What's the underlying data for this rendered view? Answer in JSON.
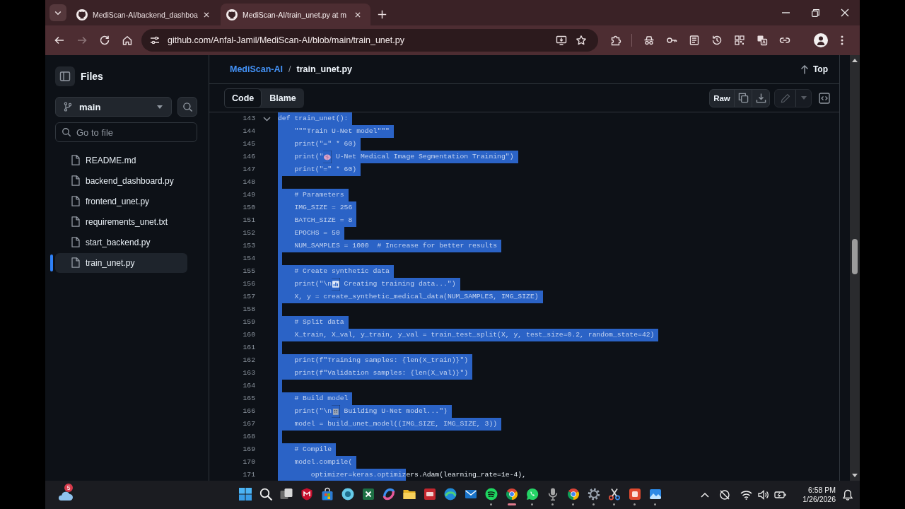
{
  "browser": {
    "tabs": [
      {
        "title": "MediScan-AI/backend_dashboa",
        "selected": false
      },
      {
        "title": "MediScan-AI/train_unet.py at m",
        "selected": true
      }
    ],
    "nav_buttons": [
      {
        "kind": "back",
        "disabled": false
      },
      {
        "kind": "forward",
        "disabled": true
      },
      {
        "kind": "reload",
        "disabled": false
      },
      {
        "kind": "home",
        "disabled": false
      }
    ],
    "address_bar": {
      "url": "github.com/Anfal-Jamil/MediScan-AI/blob/main/train_unet.py"
    }
  },
  "sidebar": {
    "title": "Files",
    "branch": "main",
    "search": {
      "placeholder": "Go to file"
    },
    "files": [
      {
        "name": "README.md",
        "selected": false
      },
      {
        "name": "backend_dashboard.py",
        "selected": false
      },
      {
        "name": "frontend_unet.py",
        "selected": false
      },
      {
        "name": "requirements_unet.txt",
        "selected": false
      },
      {
        "name": "start_backend.py",
        "selected": false
      },
      {
        "name": "train_unet.py",
        "selected": true
      }
    ]
  },
  "file_header": {
    "repo": "MediScan-AI",
    "separator": "/",
    "file": "train_unet.py",
    "top_link": "Top"
  },
  "view_tabs": [
    {
      "label": "Code",
      "selected": true
    },
    {
      "label": "Blame",
      "selected": false
    }
  ],
  "file_actions": {
    "raw": "Raw",
    "edit": {
      "disabled": true
    }
  },
  "code": {
    "lines": [
      {
        "number": "143",
        "selected": true,
        "expanded": true,
        "parts": [
          {
            "kind": "code",
            "text": "def train_unet():",
            "selected": true
          }
        ]
      },
      {
        "number": "144",
        "selected": true,
        "parts": [
          {
            "kind": "code",
            "text": "    \"\"\"Train U-Net model\"\"\"",
            "selected": true
          }
        ]
      },
      {
        "number": "145",
        "selected": true,
        "parts": [
          {
            "kind": "code",
            "text": "    print(\"=\" * 60)",
            "selected": true
          }
        ]
      },
      {
        "number": "146",
        "selected": true,
        "parts": [
          {
            "kind": "code",
            "text": "    print(\"",
            "selected": true
          },
          {
            "kind": "brain",
            "selected": true
          },
          {
            "kind": "code",
            "text": " U-Net Medical Image Segmentation Training\")",
            "selected": true
          }
        ]
      },
      {
        "number": "147",
        "selected": true,
        "parts": [
          {
            "kind": "code",
            "text": "    print(\"=\" * 60)",
            "selected": true
          }
        ]
      },
      {
        "number": "148",
        "selected": true
      },
      {
        "number": "149",
        "selected": true,
        "parts": [
          {
            "kind": "code",
            "text": "    # Parameters",
            "selected": true
          }
        ]
      },
      {
        "number": "150",
        "selected": true,
        "parts": [
          {
            "kind": "code",
            "text": "    IMG_SIZE = 256",
            "selected": true
          }
        ]
      },
      {
        "number": "151",
        "selected": true,
        "parts": [
          {
            "kind": "code",
            "text": "    BATCH_SIZE = 8",
            "selected": true
          }
        ]
      },
      {
        "number": "152",
        "selected": true,
        "parts": [
          {
            "kind": "code",
            "text": "    EPOCHS = 50",
            "selected": true
          }
        ]
      },
      {
        "number": "153",
        "selected": true,
        "parts": [
          {
            "kind": "code",
            "text": "    NUM_SAMPLES = 1000  # Increase for better results",
            "selected": true
          }
        ]
      },
      {
        "number": "154",
        "selected": true
      },
      {
        "number": "155",
        "selected": true,
        "parts": [
          {
            "kind": "code",
            "text": "    # Create synthetic data",
            "selected": true
          }
        ]
      },
      {
        "number": "156",
        "selected": true,
        "parts": [
          {
            "kind": "code",
            "text": "    print(\"\\n",
            "selected": true
          },
          {
            "kind": "chart",
            "selected": true
          },
          {
            "kind": "code",
            "text": " Creating training data...\")",
            "selected": true
          }
        ]
      },
      {
        "number": "157",
        "selected": true,
        "parts": [
          {
            "kind": "code",
            "text": "    X, y = create_synthetic_medical_data(NUM_SAMPLES, IMG_SIZE)",
            "selected": true
          }
        ]
      },
      {
        "number": "158",
        "selected": true
      },
      {
        "number": "159",
        "selected": true,
        "parts": [
          {
            "kind": "code",
            "text": "    # Split data",
            "selected": true
          }
        ]
      },
      {
        "number": "160",
        "selected": true,
        "parts": [
          {
            "kind": "code",
            "text": "    X_train, X_val, y_train, y_val = train_test_split(X, y, test_size=0.2, random_state=42)",
            "selected": true
          }
        ]
      },
      {
        "number": "161",
        "selected": true
      },
      {
        "number": "162",
        "selected": true,
        "parts": [
          {
            "kind": "code",
            "text": "    print(f\"Training samples: {len(X_train)}\")",
            "selected": true
          }
        ]
      },
      {
        "number": "163",
        "selected": true,
        "parts": [
          {
            "kind": "code",
            "text": "    print(f\"Validation samples: {len(X_val)}\")",
            "selected": true
          }
        ]
      },
      {
        "number": "164",
        "selected": true
      },
      {
        "number": "165",
        "selected": true,
        "parts": [
          {
            "kind": "code",
            "text": "    # Build model",
            "selected": true
          }
        ]
      },
      {
        "number": "166",
        "selected": true,
        "parts": [
          {
            "kind": "code",
            "text": "    print(\"\\n",
            "selected": true
          },
          {
            "kind": "building",
            "selected": true
          },
          {
            "kind": "code",
            "text": " Building U-Net model...\")",
            "selected": true
          }
        ]
      },
      {
        "number": "167",
        "selected": true,
        "parts": [
          {
            "kind": "code",
            "text": "    model = build_unet_model((IMG_SIZE, IMG_SIZE, 3))",
            "selected": true
          }
        ]
      },
      {
        "number": "168",
        "selected": true
      },
      {
        "number": "169",
        "selected": true,
        "parts": [
          {
            "kind": "code",
            "text": "    # Compile",
            "selected": true
          }
        ]
      },
      {
        "number": "170",
        "selected": true,
        "parts": [
          {
            "kind": "code",
            "text": "    model.compile(",
            "selected": true
          }
        ]
      },
      {
        "number": "171",
        "selected": false,
        "parts": [
          {
            "kind": "code",
            "text": "        optimizer=keras.optimiz",
            "selected": true
          },
          {
            "kind": "code",
            "text": "ers.Adam(learning_rate=1e-4),",
            "selected": false
          }
        ]
      }
    ]
  },
  "taskbar": {
    "weather_badge": "5",
    "apps": [
      {
        "kind": "start",
        "running": false,
        "selected": false
      },
      {
        "kind": "search",
        "running": false,
        "selected": false
      },
      {
        "kind": "task_view",
        "running": false,
        "selected": false
      },
      {
        "kind": "shield",
        "running": false,
        "selected": false
      },
      {
        "kind": "bag",
        "running": false,
        "selected": false
      },
      {
        "kind": "disc",
        "running": false,
        "selected": false
      },
      {
        "kind": "sheet",
        "running": false,
        "selected": false
      },
      {
        "kind": "swirl",
        "running": false,
        "selected": false
      },
      {
        "kind": "folder",
        "running": false,
        "selected": false
      },
      {
        "kind": "dev_tile",
        "running": false,
        "selected": false
      },
      {
        "kind": "wave",
        "running": false,
        "selected": false
      },
      {
        "kind": "mail",
        "running": false,
        "selected": false
      },
      {
        "kind": "music",
        "running": true,
        "selected": false
      },
      {
        "kind": "browser",
        "running": true,
        "selected": true
      },
      {
        "kind": "chat",
        "running": true,
        "selected": false
      },
      {
        "kind": "mic",
        "running": true,
        "selected": false
      },
      {
        "kind": "browser",
        "running": true,
        "selected": false
      },
      {
        "kind": "gear",
        "running": true,
        "selected": false
      },
      {
        "kind": "scissors",
        "running": true,
        "selected": false
      },
      {
        "kind": "red_tile",
        "running": true,
        "selected": false
      },
      {
        "kind": "photo",
        "running": true,
        "selected": false
      }
    ],
    "clock": {
      "time": "6:58 PM",
      "date": "1/26/2026"
    }
  }
}
